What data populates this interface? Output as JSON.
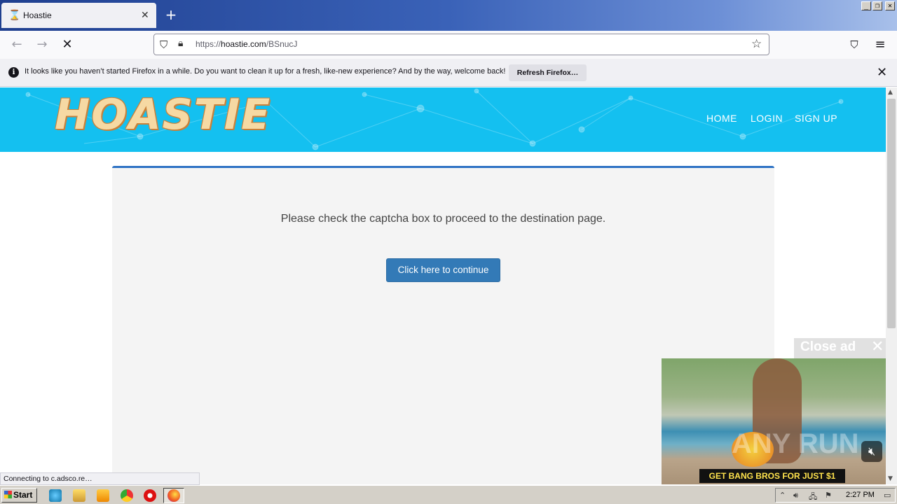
{
  "browser": {
    "tab": {
      "title": "Hoastie",
      "icon": "hourglass-icon"
    },
    "url": {
      "scheme": "https://",
      "host": "hoastie.com",
      "path": "/BSnucJ"
    },
    "notification": {
      "text": "It looks like you haven’t started Firefox in a while. Do you want to clean it up for a fresh, like-new experience? And by the way, welcome back!",
      "button": "Refresh Firefox…"
    },
    "status_text": "Connecting to c.adsco.re…"
  },
  "site": {
    "logo": "HOASTIE",
    "nav": [
      "HOME",
      "LOGIN",
      "SIGN UP"
    ],
    "header_color": "#14c0f0",
    "panel": {
      "message": "Please check the captcha box to proceed to the destination page.",
      "button": "Click here to continue",
      "accent": "#337ab7"
    }
  },
  "ad": {
    "close_label": "Close ad",
    "banner": "GET BANG BROS FOR JUST $1",
    "watermark": "ANY RUN"
  },
  "taskbar": {
    "start_label": "Start",
    "clock": "2:27 PM"
  }
}
